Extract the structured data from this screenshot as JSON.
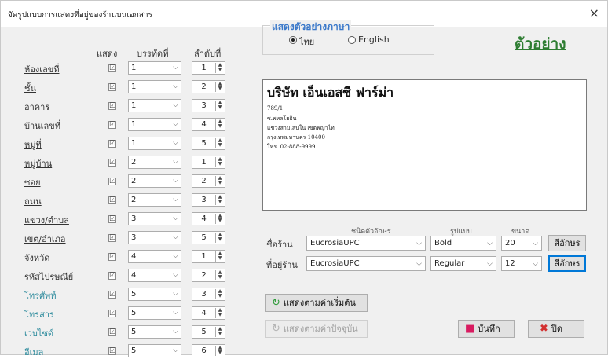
{
  "window": {
    "title": "จัดรูปแบบการแสดงที่อยู่ของร้านบนเอกสาร",
    "close_glyph": "×"
  },
  "columns": {
    "show": "แสดง",
    "line": "บรรทัดที่",
    "order": "ลำดับที่"
  },
  "rows": [
    {
      "label": "ห้องเลขที่",
      "style": "u",
      "checked": "☑",
      "line": "1",
      "order": "1"
    },
    {
      "label": "ชั้น",
      "style": "u",
      "checked": "☑",
      "line": "1",
      "order": "2"
    },
    {
      "label": "อาคาร",
      "style": "n",
      "checked": "☑",
      "line": "1",
      "order": "3"
    },
    {
      "label": "บ้านเลขที่",
      "style": "n",
      "checked": "☑",
      "line": "1",
      "order": "4"
    },
    {
      "label": "หมู่ที่",
      "style": "u",
      "checked": "☑",
      "line": "1",
      "order": "5"
    },
    {
      "label": "หมู่บ้าน",
      "style": "u",
      "checked": "☑",
      "line": "2",
      "order": "1"
    },
    {
      "label": "ซอย",
      "style": "u",
      "checked": "☑",
      "line": "2",
      "order": "2"
    },
    {
      "label": "ถนน",
      "style": "u",
      "checked": "☑",
      "line": "2",
      "order": "3"
    },
    {
      "label": "แขวง/ตำบล",
      "style": "u",
      "checked": "☑",
      "line": "3",
      "order": "4"
    },
    {
      "label": "เขต/อำเภอ",
      "style": "u",
      "checked": "☑",
      "line": "3",
      "order": "5"
    },
    {
      "label": "จังหวัด",
      "style": "u",
      "checked": "☑",
      "line": "4",
      "order": "1"
    },
    {
      "label": "รหัสไปรษณีย์",
      "style": "n",
      "checked": "☑",
      "line": "4",
      "order": "2"
    },
    {
      "label": "โทรศัพท์",
      "style": "t",
      "checked": "☑",
      "line": "5",
      "order": "3"
    },
    {
      "label": "โทรสาร",
      "style": "t",
      "checked": "☑",
      "line": "5",
      "order": "4"
    },
    {
      "label": "เวบไซต์",
      "style": "t",
      "checked": "☑",
      "line": "5",
      "order": "5"
    },
    {
      "label": "อีเมล",
      "style": "t",
      "checked": "☑",
      "line": "5",
      "order": "6"
    }
  ],
  "language_group": {
    "title": "แสดงตัวอย่างภาษา",
    "thai": "ไทย",
    "english": "English",
    "selected": "thai"
  },
  "example_link": "ตัวอย่าง",
  "preview": {
    "title": "บริษัท เอ็นเอสซี ฟาร์ม่า",
    "lines": [
      "789/1",
      "ซ.พหลโยธิน",
      "แขวงสามเสนใน เขตพญาไท",
      "กรุงเทพมหานคร 10400",
      "โทร. 02-888-9999"
    ]
  },
  "font_columns": {
    "font": "ชนิดตัวอักษร",
    "style": "รูปแบบ",
    "size": "ขนาด"
  },
  "font_rows": [
    {
      "label": "ชื่อร้าน",
      "font": "EucrosiaUPC",
      "style": "Bold",
      "size": "20",
      "button": "สีอักษร"
    },
    {
      "label": "ที่อยู่ร้าน",
      "font": "EucrosiaUPC",
      "style": "Regular",
      "size": "12",
      "button": "สีอักษร"
    }
  ],
  "buttons": {
    "reset": "แสดงตามค่าเริ่มต้น",
    "current": "แสดงตามค่าปัจจุบัน",
    "save": "บันทึก",
    "close": "ปิด"
  },
  "glyphs": {
    "arrow": "⌵",
    "spin_up": "▲",
    "spin_down": "▼",
    "refresh": "↻",
    "save": "■",
    "close": "✖"
  },
  "colors": {
    "accent": "#3a78c9",
    "example": "#2e7d32",
    "teal_label": "#2b8a9c",
    "close_icon": "#d32f2f",
    "save_icon": "#d81b60",
    "refresh_icon": "#2e9b3a"
  }
}
